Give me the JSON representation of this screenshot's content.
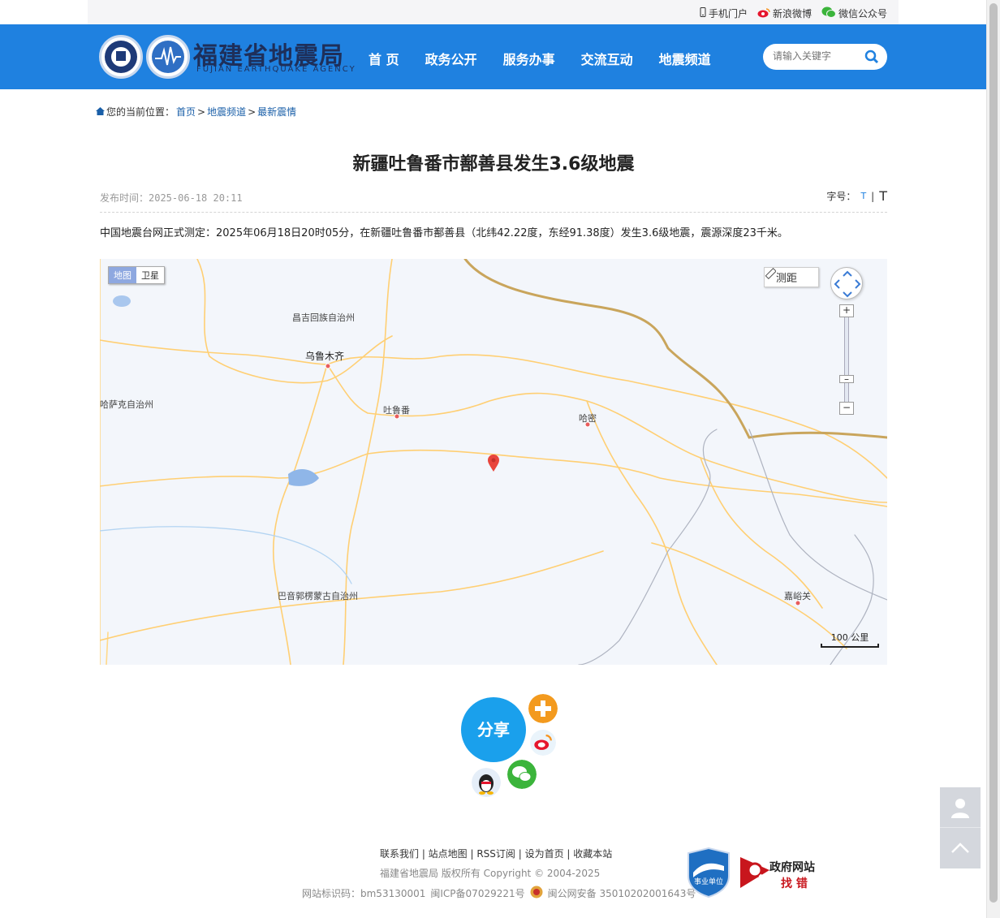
{
  "topbar": {
    "mobile": "手机门户",
    "weibo": "新浪微博",
    "wechat": "微信公众号"
  },
  "header": {
    "title": "福建省地震局",
    "subtitle": "FUJIAN EARTHQUAKE AGENCY",
    "nav": [
      "首 页",
      "政务公开",
      "服务办事",
      "交流互动",
      "地震频道"
    ],
    "search_placeholder": "请输入关键字"
  },
  "breadcrumb": {
    "prefix": "您的当前位置：",
    "items": [
      "首页",
      "地震频道",
      "最新震情"
    ],
    "sep": ">"
  },
  "article": {
    "title": "新疆吐鲁番市鄯善县发生3.6级地震",
    "pubtime": "发布时间：2025-06-18 20:11",
    "fontsize_label": "字号：",
    "fontsize_small": "T",
    "fontsize_sep": "|",
    "fontsize_big": "T",
    "summary": "中国地震台网正式测定：2025年06月18日20时05分，在新疆吐鲁番市鄯善县（北纬42.22度，东经91.38度）发生3.6级地震，震源深度23千米。"
  },
  "map": {
    "type_map": "地图",
    "type_satellite": "卫星",
    "ruler": "测距",
    "zoom_in": "+",
    "zoom_out": "−",
    "scale": "100 公里",
    "labels": {
      "changji": "昌吉回族自治州",
      "urumqi": "乌鲁木齐",
      "kazakh": "哈萨克自治州",
      "turpan": "吐鲁番",
      "hami": "哈密",
      "bayingol": "巴音郭楞蒙古自治州",
      "jiayuguan": "嘉峪关"
    }
  },
  "share": {
    "label": "分享"
  },
  "footer": {
    "links": "联系我们 | 站点地图 | RSS订阅 | 设为首页 | 收藏本站",
    "copy": "福建省地震局  版权所有   Copyright © 2004-2025",
    "site_id": "网站标识码：bm53130001",
    "icp": "闽ICP备07029221号",
    "police": "闽公网安备 35010202001643号",
    "badge1": "事业单位",
    "badge2_top": "政府网站",
    "badge2_bottom": "找 错"
  },
  "colors": {
    "header_bg": "#1f81e0",
    "share": "#1aa0ec",
    "marker": "#e8453c"
  }
}
